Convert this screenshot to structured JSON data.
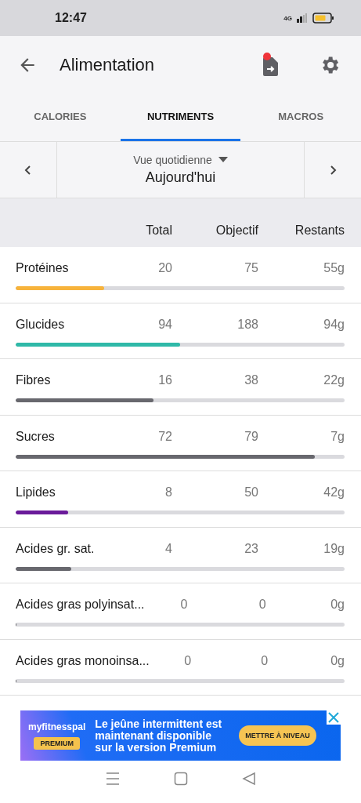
{
  "status_bar": {
    "time": "12:47",
    "network": "4G"
  },
  "header": {
    "title": "Alimentation",
    "export_notification": true
  },
  "tabs": [
    {
      "label": "CALORIES",
      "selected": false
    },
    {
      "label": "NUTRIMENTS",
      "selected": true
    },
    {
      "label": "MACROS",
      "selected": false
    }
  ],
  "date_nav": {
    "view": "Vue quotidienne",
    "date": "Aujourd'hui"
  },
  "table": {
    "columns": [
      "Total",
      "Objectif",
      "Restants"
    ],
    "rows": [
      {
        "name": "Protéines",
        "total": "20",
        "goal": "75",
        "remaining": "55g",
        "level": 0.27,
        "color": "#f7b33b"
      },
      {
        "name": "Glucides",
        "total": "94",
        "goal": "188",
        "remaining": "94g",
        "level": 0.5,
        "color": "#2fb9a8"
      },
      {
        "name": "Fibres",
        "total": "16",
        "goal": "38",
        "remaining": "22g",
        "level": 0.42,
        "color": "#68686e"
      },
      {
        "name": "Sucres",
        "total": "72",
        "goal": "79",
        "remaining": "7g",
        "level": 0.91,
        "color": "#68686e"
      },
      {
        "name": "Lipides",
        "total": "8",
        "goal": "50",
        "remaining": "42g",
        "level": 0.16,
        "color": "#6a1b9a"
      },
      {
        "name": "Acides gr. sat.",
        "total": "4",
        "goal": "23",
        "remaining": "19g",
        "level": 0.17,
        "color": "#68686e"
      },
      {
        "name": "Acides gras polyinsat...",
        "total": "0",
        "goal": "0",
        "remaining": "0g",
        "level": 0
      },
      {
        "name": "Acides gras monoinsa...",
        "total": "0",
        "goal": "0",
        "remaining": "0g",
        "level": 0
      }
    ]
  },
  "ad": {
    "brand": "myfitnesspal",
    "badge": "PREMIUM",
    "message": "Le jeûne intermittent est maintenant disponible sur la version Premium",
    "button": "METTRE À NIVEAU"
  }
}
